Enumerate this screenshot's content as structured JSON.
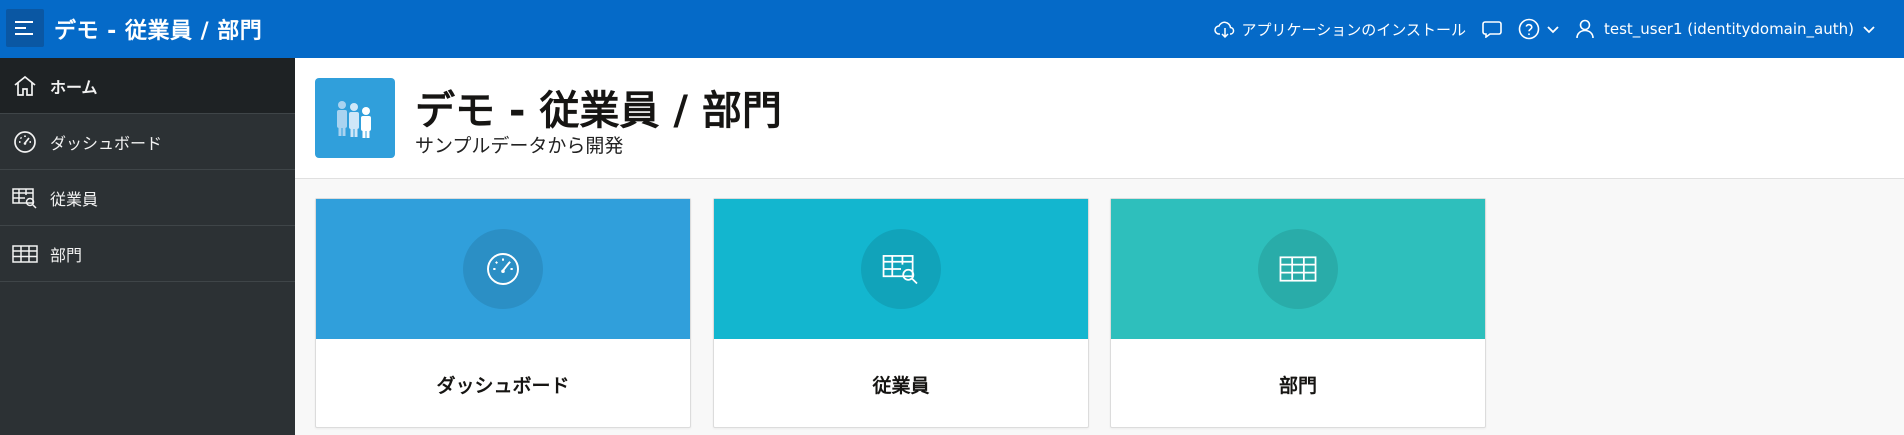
{
  "header": {
    "app_title": "デモ - 従業員 / 部門",
    "install_label": "アプリケーションのインストール",
    "user_label": "test_user1 (identitydomain_auth)",
    "accent": "#056ac8"
  },
  "sidebar": {
    "items": [
      {
        "label": "ホーム",
        "icon": "home-icon",
        "active": true
      },
      {
        "label": "ダッシュボード",
        "icon": "dashboard-gauge-icon",
        "active": false
      },
      {
        "label": "従業員",
        "icon": "table-search-icon",
        "active": false
      },
      {
        "label": "部門",
        "icon": "table-grid-icon",
        "active": false
      }
    ]
  },
  "page": {
    "title": "デモ - 従業員 / 部門",
    "subtitle": "サンプルデータから開発",
    "icon": "people-group-icon"
  },
  "cards": [
    {
      "label": "ダッシュボード",
      "icon": "dashboard-gauge-icon",
      "color": "#309fdb"
    },
    {
      "label": "従業員",
      "icon": "table-search-icon",
      "color": "#13b6cf"
    },
    {
      "label": "部門",
      "icon": "table-grid-icon",
      "color": "#2ebfbc"
    }
  ]
}
